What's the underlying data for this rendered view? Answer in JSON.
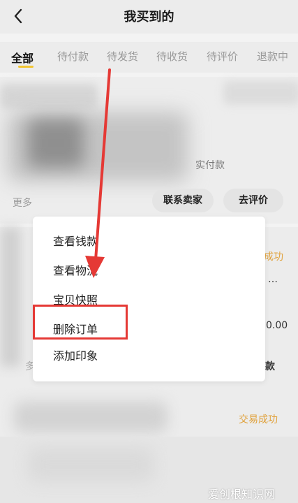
{
  "header": {
    "title": "我买到的",
    "back_icon": "chevron-left-icon"
  },
  "tabs": [
    {
      "label": "全部",
      "active": true
    },
    {
      "label": "待付款",
      "active": false
    },
    {
      "label": "待发货",
      "active": false
    },
    {
      "label": "待收货",
      "active": false
    },
    {
      "label": "待评价",
      "active": false
    },
    {
      "label": "退款中",
      "active": false
    }
  ],
  "order1": {
    "paid_label": "实付款",
    "more_label": "更多",
    "contact_seller_label": "联系卖家",
    "review_label": "去评价"
  },
  "order2": {
    "status_top": "成功",
    "title_peek": "…",
    "price_peek": "0.00",
    "button_peek": "款",
    "left_peek": "多",
    "status_bottom": "交易成功"
  },
  "menu": {
    "items": [
      {
        "label": "查看钱款"
      },
      {
        "label": "查看物流"
      },
      {
        "label": "宝贝快照"
      },
      {
        "label": "删除订单"
      },
      {
        "label": "添加印象"
      }
    ],
    "highlighted_index": 3
  },
  "colors": {
    "accent_tab_underline": "#f2c531",
    "annotation_red": "#e53935",
    "status_orange": "#e0a13a"
  },
  "watermark": "爱创根知识网"
}
